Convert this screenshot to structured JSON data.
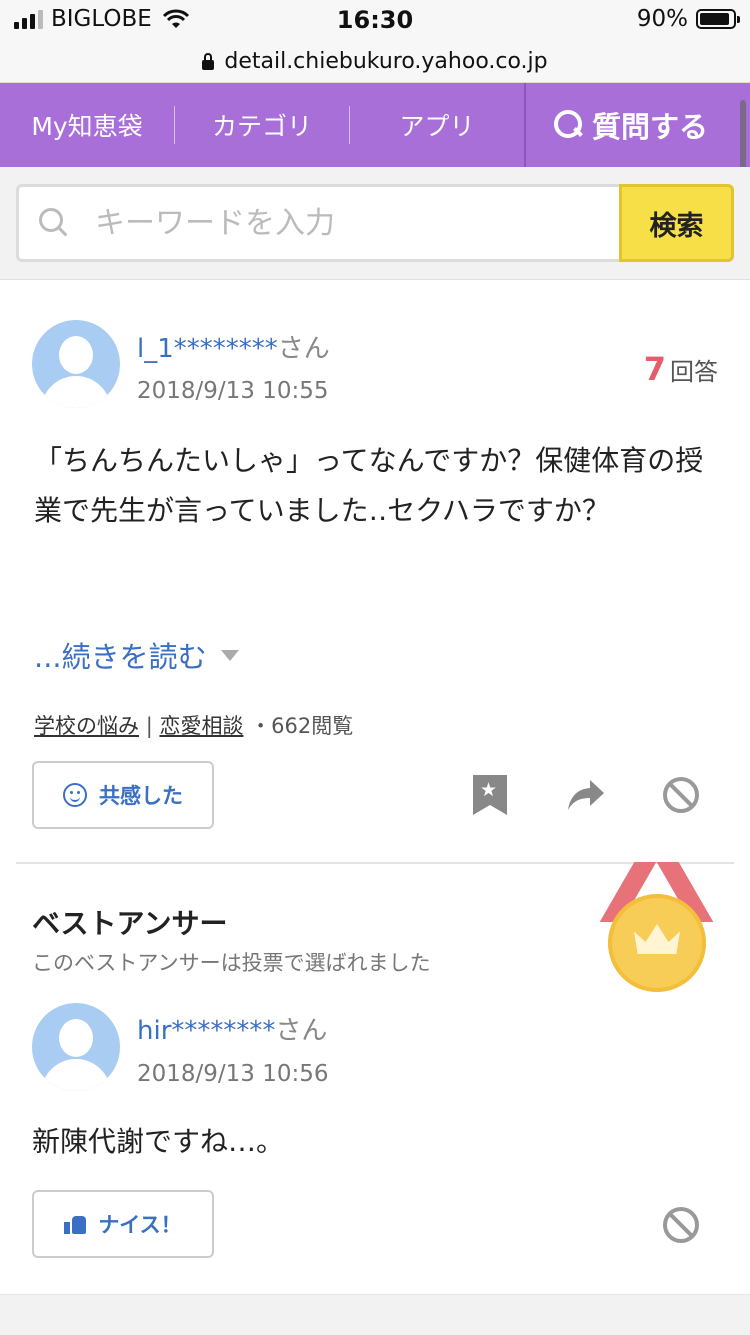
{
  "status_bar": {
    "carrier": "BIGLOBE",
    "time": "16:30",
    "battery_percent_label": "90%",
    "battery_level": 0.9
  },
  "url_bar": {
    "url": "detail.chiebukuro.yahoo.co.jp"
  },
  "nav": {
    "items": [
      "My知恵袋",
      "カテゴリ",
      "アプリ"
    ],
    "ask_label": "質問する",
    "accent_color": "#a86fd8"
  },
  "search": {
    "placeholder": "キーワードを入力",
    "button_label": "検索",
    "button_color": "#f7df47"
  },
  "question": {
    "user_name": "l_1********",
    "user_suffix": "さん",
    "date": "2018/9/13 10:55",
    "answer_count": "7",
    "answer_count_label": "回答",
    "text": "「ちんちんたいしゃ」ってなんですか？保健体育の授業で先生が言っていました‥セクハラですか？",
    "read_more": "...続きを読む",
    "category_1": "学校の悩み",
    "category_separator": "|",
    "category_2": "恋愛相談",
    "views": "・662閲覧",
    "empathy_label": "共感した"
  },
  "best_answer": {
    "title": "ベストアンサー",
    "subtitle": "このベストアンサーは投票で選ばれました",
    "user_name": "hir********",
    "user_suffix": "さん",
    "date": "2018/9/13 10:56",
    "text": "新陳代謝ですね…。",
    "nice_label": "ナイス！"
  },
  "icons": [
    "search-icon",
    "bookmark-icon",
    "share-icon",
    "block-icon",
    "smile-icon",
    "thumbs-up-icon",
    "medal-icon",
    "lock-icon",
    "wifi-icon"
  ]
}
